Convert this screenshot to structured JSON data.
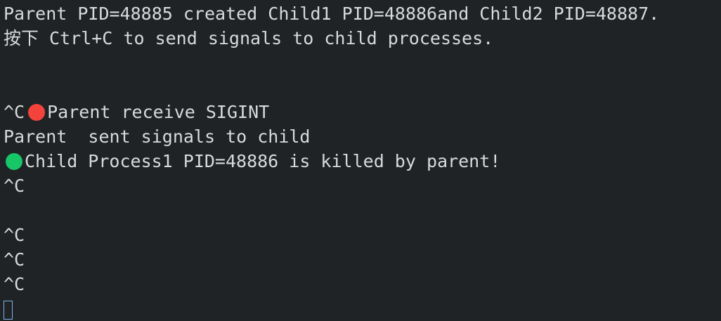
{
  "terminal": {
    "lines": {
      "l0": "Parent PID=48885 created Child1 PID=48886and Child2 PID=48887.",
      "l1": "按下 Ctrl+C to send signals to child processes.",
      "l4_prefix": "^C",
      "l4_text": "Parent receive SIGINT",
      "l5": "Parent  sent signals to child",
      "l6_text": "Child Process1 PID=48886 is killed by parent!",
      "l7": "^C",
      "l9": "^C",
      "l10": "^C",
      "l11": "^C"
    },
    "colors": {
      "background": "#1f2326",
      "foreground": "#d8dadc",
      "red_dot": "#f4433b",
      "green_dot": "#16c667",
      "cursor": "#7fb2e8"
    },
    "icons": {
      "red_circle": "red-circle-emoji-icon",
      "green_circle": "green-circle-emoji-icon"
    }
  }
}
